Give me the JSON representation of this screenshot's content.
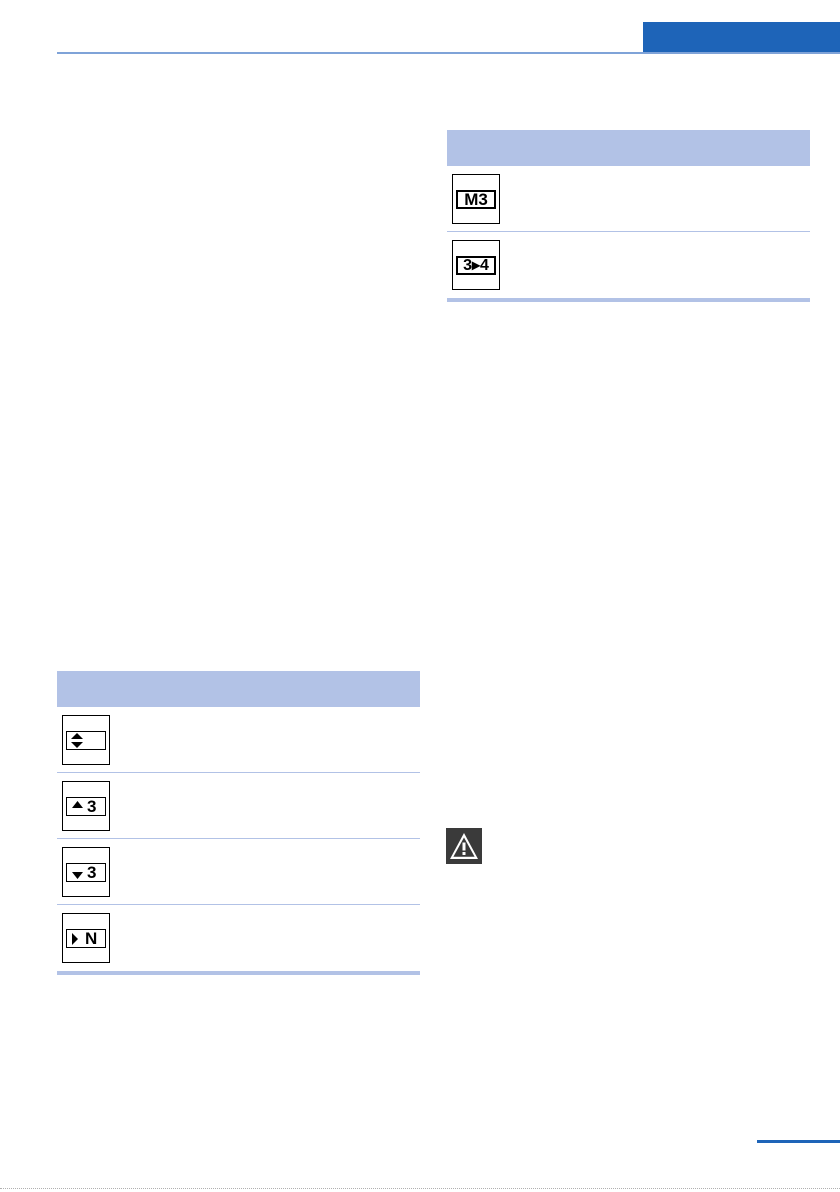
{
  "page": {
    "accent": "#1e64b8",
    "table_accent": "#b2c2e6"
  },
  "table_right": {
    "rows": [
      {
        "icon": "manual-gear-3-icon",
        "text": "M3"
      },
      {
        "icon": "gear-shift-3-to-4-icon",
        "text": "3▸4"
      }
    ]
  },
  "table_left": {
    "rows": [
      {
        "icon": "shift-up-down-icon"
      },
      {
        "icon": "upshift-3-icon",
        "text": "3"
      },
      {
        "icon": "downshift-3-icon",
        "text": "3"
      },
      {
        "icon": "neutral-n-icon",
        "text": "N"
      }
    ]
  },
  "warning": {
    "icon": "warning-triangle-icon"
  }
}
